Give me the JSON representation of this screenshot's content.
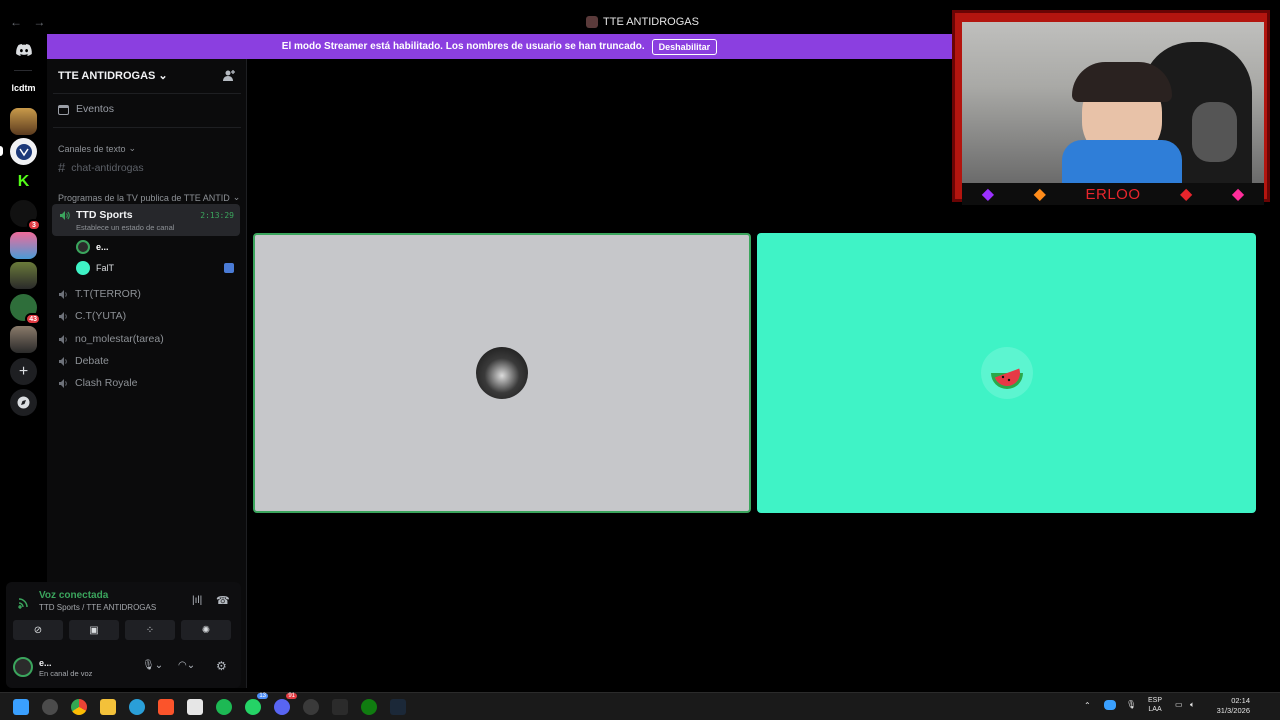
{
  "window": {
    "title": "TTE ANTIDROGAS",
    "nav_arrows": "← →"
  },
  "banner": {
    "text": "El modo Streamer está habilitado. Los nombres de usuario se han truncado.",
    "button": "Deshabilitar"
  },
  "rail": {
    "items": [
      {
        "name": "home",
        "label": ""
      },
      {
        "name": "lcdtm",
        "label": "lcdtm"
      },
      {
        "name": "server-2",
        "label": ""
      },
      {
        "name": "server-3",
        "label": ""
      },
      {
        "name": "kick",
        "label": "K"
      },
      {
        "name": "server-5",
        "label": "",
        "badge": "3"
      },
      {
        "name": "server-6",
        "label": ""
      },
      {
        "name": "server-7",
        "label": ""
      },
      {
        "name": "server-8",
        "label": "",
        "badge": "43"
      },
      {
        "name": "server-9",
        "label": ""
      }
    ]
  },
  "sidebar": {
    "server_name": "TTE ANTIDROGAS",
    "events": "Eventos",
    "text_category": "Canales de texto",
    "text_channel": "chat-antidrogas",
    "voice_category": "Programas de la TV publica de TTE ANTID",
    "active_voice": {
      "name": "TTD Sports",
      "status": "Establece un estado de canal",
      "timer": "2:13:29"
    },
    "members": [
      {
        "name": "e..."
      },
      {
        "name": "FalT"
      }
    ],
    "voice_channels": [
      "T.T(TERROR)",
      "C.T(YUTA)",
      "no_molestar(tarea)",
      "Debate",
      "Clash Royale"
    ]
  },
  "voice_panel": {
    "title": "Voz conectada",
    "subtitle": "TTD Sports / TTE ANTIDROGAS"
  },
  "user_panel": {
    "name": "e...",
    "status": "En canal de voz"
  },
  "webcam": {
    "name": "ERLOO"
  },
  "taskbar": {
    "lang": "ESP",
    "lang2": "LAA",
    "time": "02:14",
    "date": "31/3/2026",
    "discord_badge": "91",
    "whatsapp_badge": "13"
  },
  "colors": {
    "banner": "#8b3fe0",
    "speaking": "#3ba55d",
    "tile_right": "#3ff3c6",
    "cam_frame": "#b3150f"
  }
}
